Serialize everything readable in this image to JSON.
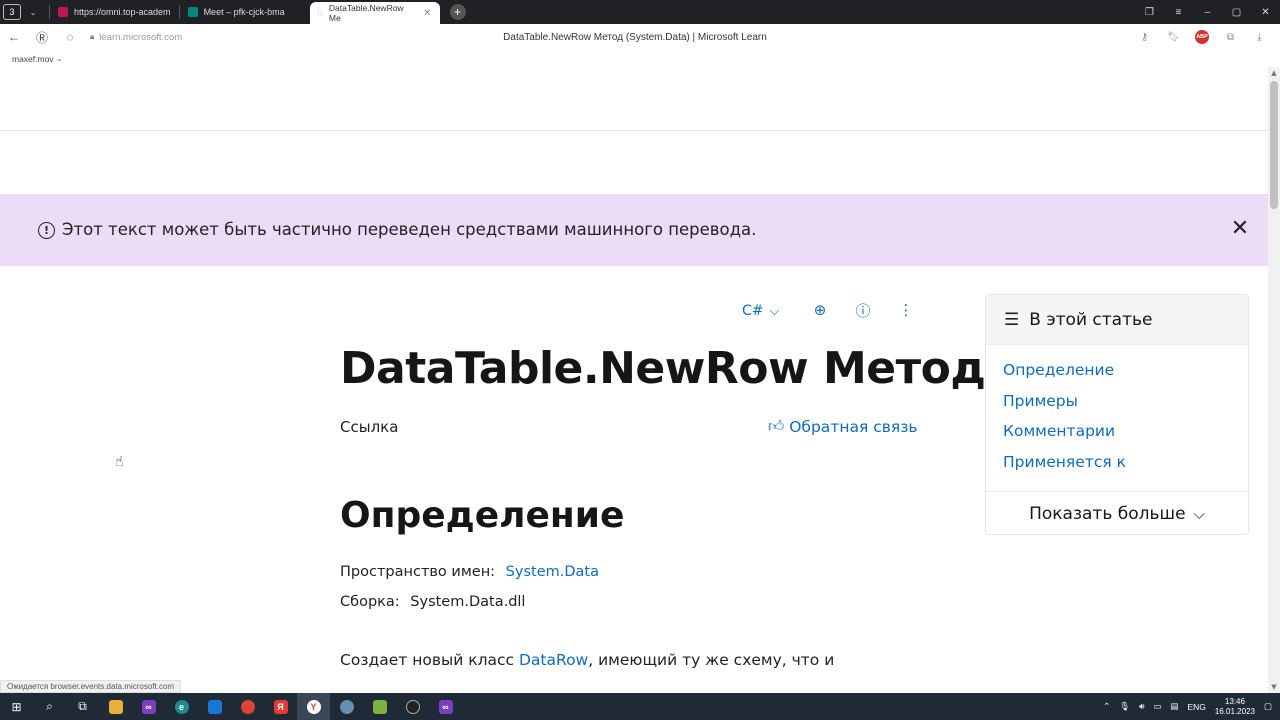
{
  "browser": {
    "tab_count": "3",
    "tabs": [
      {
        "title": "https://omni.top-academ",
        "color": "#c2185b"
      },
      {
        "title": "Meet – pfk-cjck-bma",
        "color": "#00897b"
      },
      {
        "title": "DataTable.NewRow Ме",
        "color": "#555555"
      }
    ],
    "url": "learn.microsoft.com",
    "window_title": "DataTable.NewRow Метод (System.Data) | Microsoft Learn",
    "adblock_label": "ABP",
    "bookmark": "maxef:mov"
  },
  "banner": {
    "text": "Этот текст может быть частично переведен средствами машинного перевода."
  },
  "actions": {
    "language": "C#"
  },
  "article": {
    "title": "DataTable.NewRow Метод",
    "reference": "Ссылка",
    "feedback": "Обратная связь",
    "section_title": "Определение",
    "namespace_label": "Пространство имен:",
    "namespace_value": "System.Data",
    "assembly_label": "Сборка:",
    "assembly_value": "System.Data.dll",
    "summary_prefix": "Создает новый класс ",
    "summary_link": "DataRow",
    "summary_suffix": ", имеющий ту же схему, что и"
  },
  "toc": {
    "title": "В этой статье",
    "items": [
      "Определение",
      "Примеры",
      "Комментарии",
      "Применяется к"
    ],
    "show_more": "Показать больше"
  },
  "status_bar": "Ожидается browser.events.data.microsoft.com",
  "taskbar": {
    "lang": "ENG",
    "time": "13:46",
    "date": "16.01.2023"
  },
  "colors": {
    "accent": "#0f6cbd",
    "banner_bg": "#ecdcf8"
  }
}
